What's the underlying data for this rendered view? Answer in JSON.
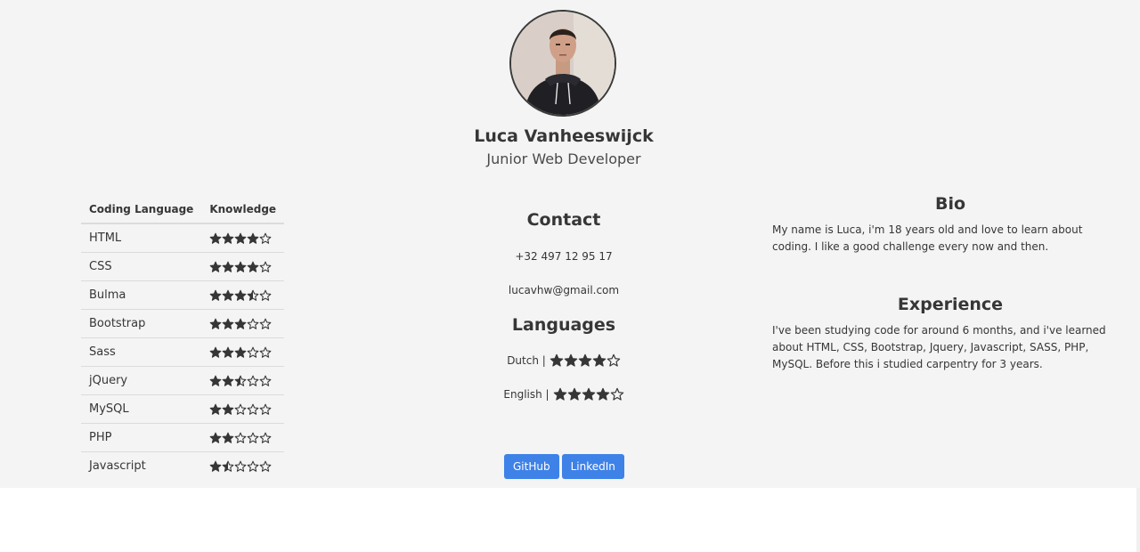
{
  "profile": {
    "name": "Luca Vanheeswijck",
    "title": "Junior Web Developer"
  },
  "skills": {
    "headers": [
      "Coding Language",
      "Knowledge"
    ],
    "rows": [
      {
        "language": "HTML",
        "rating": 4
      },
      {
        "language": "CSS",
        "rating": 4
      },
      {
        "language": "Bulma",
        "rating": 3.5
      },
      {
        "language": "Bootstrap",
        "rating": 3
      },
      {
        "language": "Sass",
        "rating": 3
      },
      {
        "language": "jQuery",
        "rating": 2.5
      },
      {
        "language": "MySQL",
        "rating": 2
      },
      {
        "language": "PHP",
        "rating": 2
      },
      {
        "language": "Javascript",
        "rating": 1.5
      }
    ],
    "max_rating": 5
  },
  "contact": {
    "title": "Contact",
    "phone": "+32 497 12 95 17",
    "email": "lucavhw@gmail.com"
  },
  "languages": {
    "title": "Languages",
    "items": [
      {
        "label": "Dutch |",
        "rating": 4
      },
      {
        "label": "English |",
        "rating": 4
      }
    ]
  },
  "links": {
    "github": "GitHub",
    "linkedin": "LinkedIn"
  },
  "bio": {
    "title": "Bio",
    "text": "My name is Luca, i'm 18 years old and love to learn about coding. I like a good challenge every now and then."
  },
  "experience": {
    "title": "Experience",
    "text": "I've been studying code for around 6 months, and i've learned about HTML, CSS, Bootstrap, Jquery, Javascript, SASS, PHP, MySQL. Before this i studied carpentry for 3 years."
  },
  "colors": {
    "background": "#f4f4f4",
    "text": "#363636",
    "button": "#3e82e8",
    "star": "#363636"
  },
  "icons": {
    "full": "star-full-icon",
    "half": "star-half-icon",
    "empty": "star-empty-icon"
  }
}
